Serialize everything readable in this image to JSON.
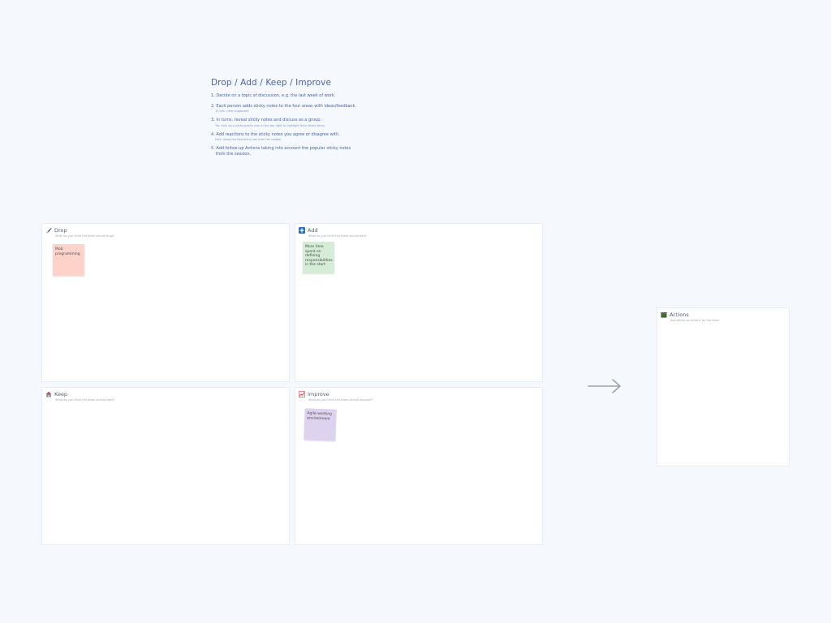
{
  "instructions": {
    "title": "Drop / Add / Keep / Improve",
    "steps": [
      {
        "text": "1. Decide on a topic of discussion, e.g. the last week of work.",
        "sub": ""
      },
      {
        "text": "2. Each person adds sticky notes to the four areas with ideas/feedback.",
        "sub": "10 min. time suggested"
      },
      {
        "text": "3. In turns, reveal sticky notes and discuss as a group.",
        "sub": "Tip: click on a participant's icon in the top right to highlight their latest sticky"
      },
      {
        "text": "4. Add reactions to the sticky notes you agree or disagree with.",
        "sub": "Hint: Using the Reactions tool from the toolbar"
      },
      {
        "text": "5. Add follow-up Actions taking into account the popular sticky notes",
        "text2": "from the session.",
        "sub": ""
      }
    ]
  },
  "panels": {
    "drop": {
      "title": "Drop",
      "subtitle": "What do you think the team should drop?",
      "icon": "paintbrush-icon",
      "icon_color": "#2c3e7a"
    },
    "add": {
      "title": "Add",
      "subtitle": "What do you think the team should add?",
      "icon": "plus-square-icon",
      "icon_color": "#2a6fb8"
    },
    "keep": {
      "title": "Keep",
      "subtitle": "What do you think the team should keep?",
      "icon": "house-icon",
      "icon_color": "#8a8f96"
    },
    "improve": {
      "title": "Improve",
      "subtitle": "What do you think the team should improve?",
      "icon": "chart-up-icon",
      "icon_color": "#d9443a"
    },
    "actions": {
      "title": "Actions",
      "subtitle": "Add follow up actions for the team",
      "icon": "clapperboard-icon",
      "icon_color": "#3d6b2e"
    }
  },
  "stickies": {
    "drop": {
      "text": "Mob programming",
      "color": "#fdd3c9"
    },
    "add": {
      "text": "More time spent on defining responsibilities in the start",
      "color": "#d5ecd7"
    },
    "improve": {
      "text": "Agile working environment",
      "color": "#ddd3ef"
    }
  },
  "arrow": {
    "icon": "arrow-right-icon",
    "color": "#9aa4af"
  }
}
